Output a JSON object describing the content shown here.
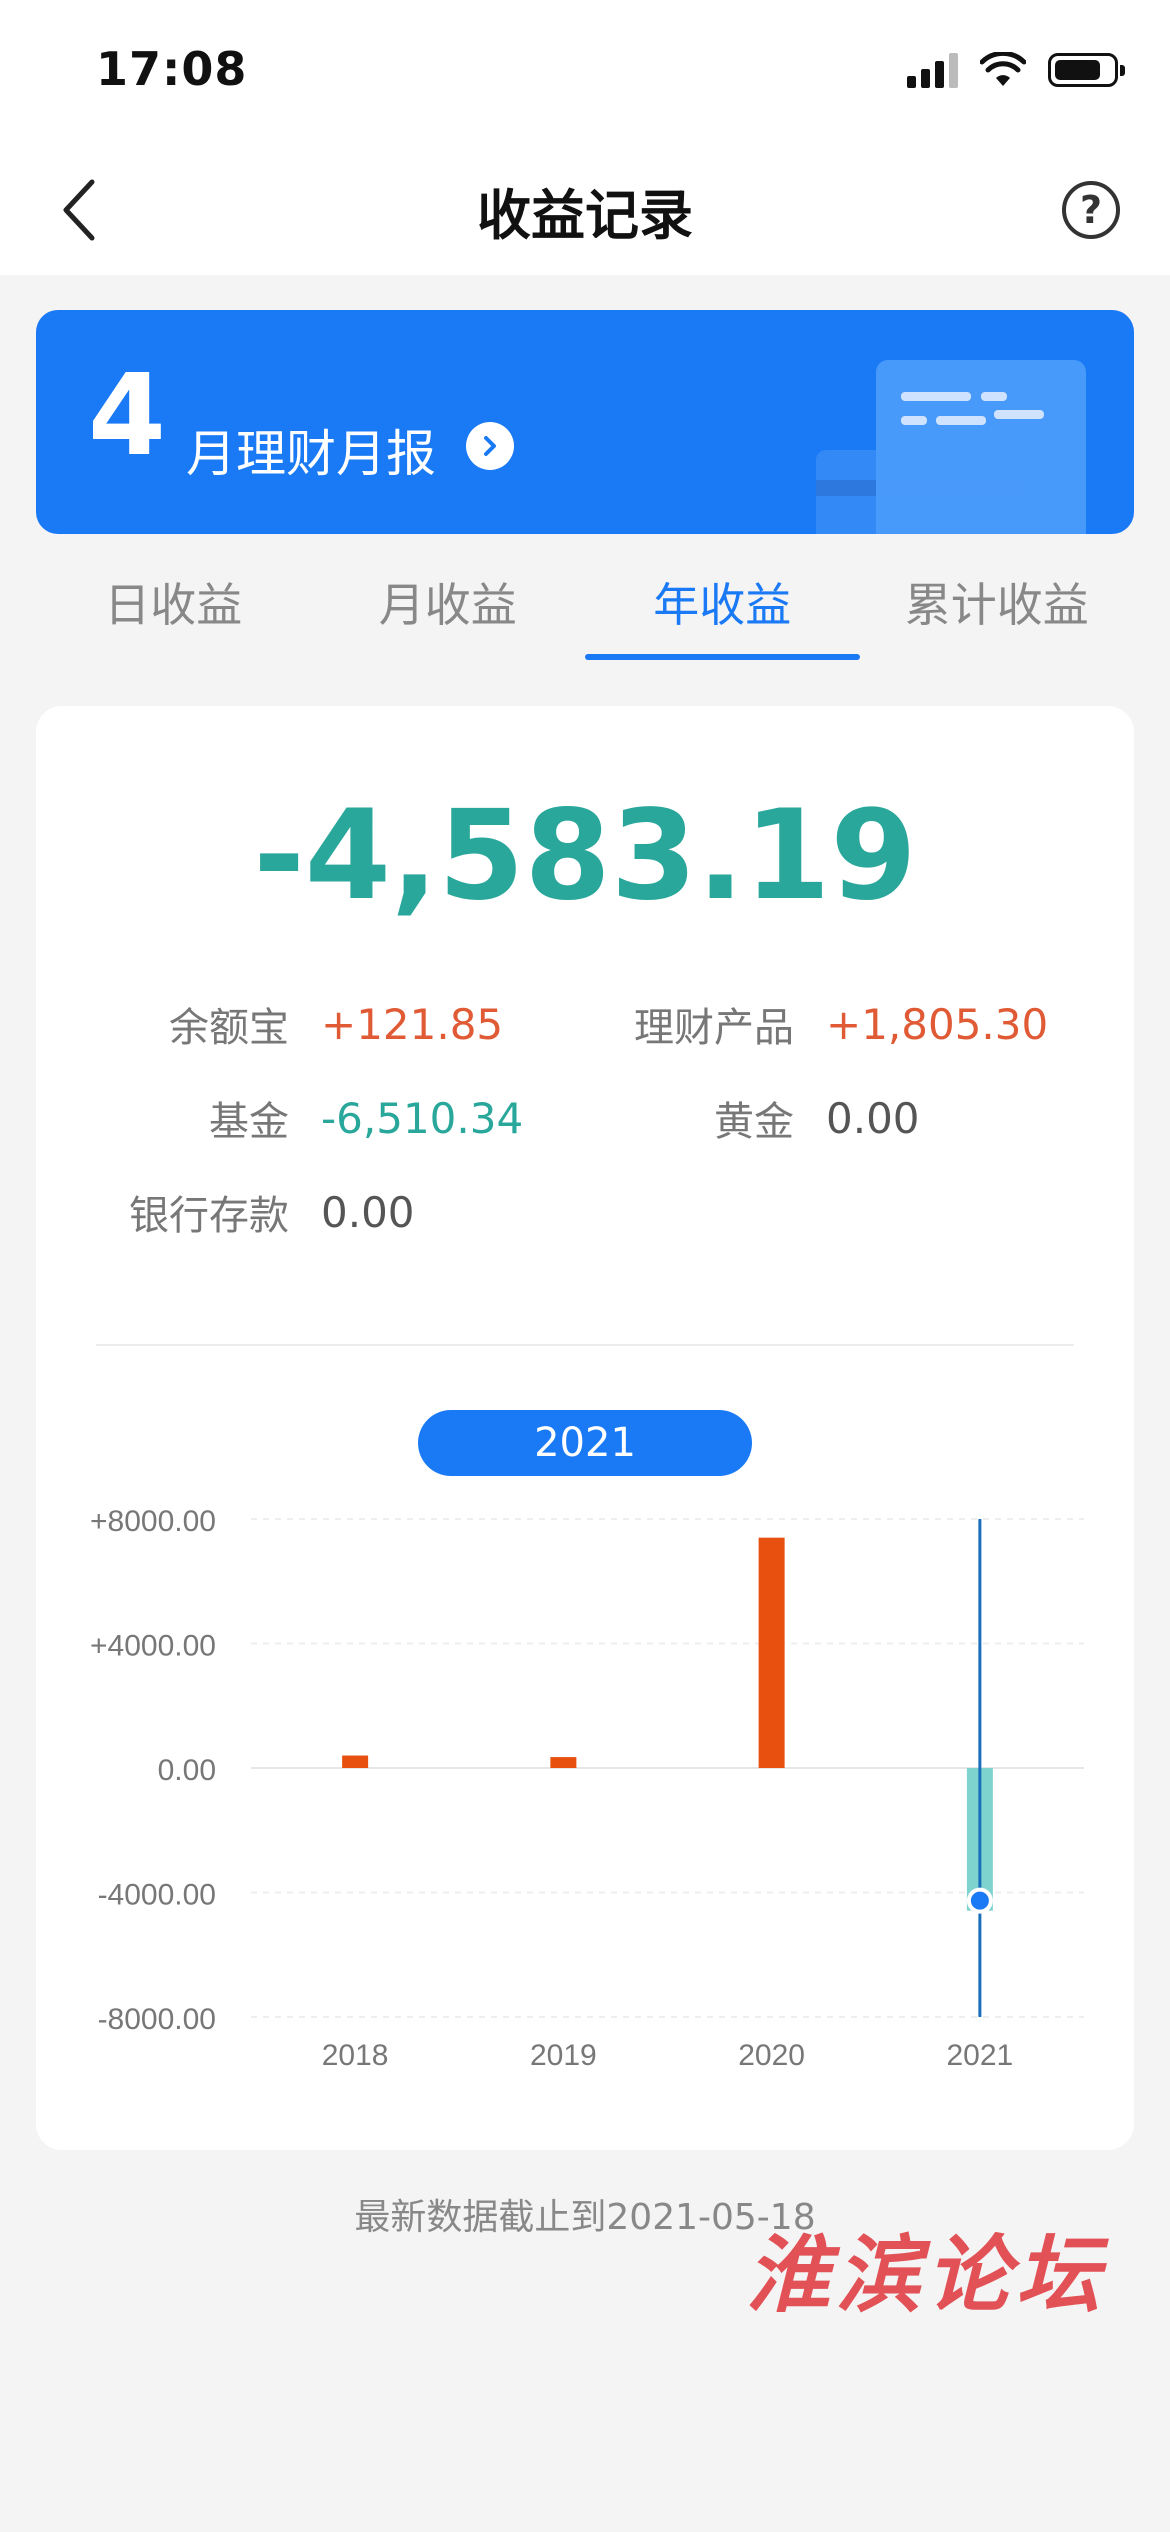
{
  "status": {
    "time": "17:08"
  },
  "nav": {
    "title": "收益记录",
    "help_symbol": "?"
  },
  "banner": {
    "month_number": "4",
    "title": "月理财月报"
  },
  "tabs": [
    {
      "label": "日收益",
      "active": false
    },
    {
      "label": "月收益",
      "active": false
    },
    {
      "label": "年收益",
      "active": true
    },
    {
      "label": "累计收益",
      "active": false
    }
  ],
  "summary": {
    "total": "-4,583.19",
    "items": [
      {
        "label": "余额宝",
        "value": "+121.85",
        "tone": "red"
      },
      {
        "label": "理财产品",
        "value": "+1,805.30",
        "tone": "red"
      },
      {
        "label": "基金",
        "value": "-6,510.34",
        "tone": "green"
      },
      {
        "label": "黄金",
        "value": "0.00",
        "tone": "gray"
      },
      {
        "label": "银行存款",
        "value": "0.00",
        "tone": "gray"
      }
    ]
  },
  "selected_year": "2021",
  "chart_data": {
    "type": "bar",
    "categories": [
      "2018",
      "2019",
      "2020",
      "2021"
    ],
    "values": [
      400,
      350,
      7400,
      -4583.19
    ],
    "ylim": [
      -8000,
      8000
    ],
    "yticks": [
      8000,
      4000,
      0,
      -4000,
      -8000
    ],
    "ytick_labels": [
      "+8000.00",
      "+4000.00",
      "0.00",
      "-4000.00",
      "-8000.00"
    ],
    "selected_index": 3,
    "colors": {
      "positive": "#e8500f",
      "negative": "#7fd3cf",
      "cursor": "#1a6fbd",
      "point": "#1a7af5"
    },
    "grid": true
  },
  "footnote": "最新数据截止到2021-05-18",
  "watermark": "淮滨论坛"
}
